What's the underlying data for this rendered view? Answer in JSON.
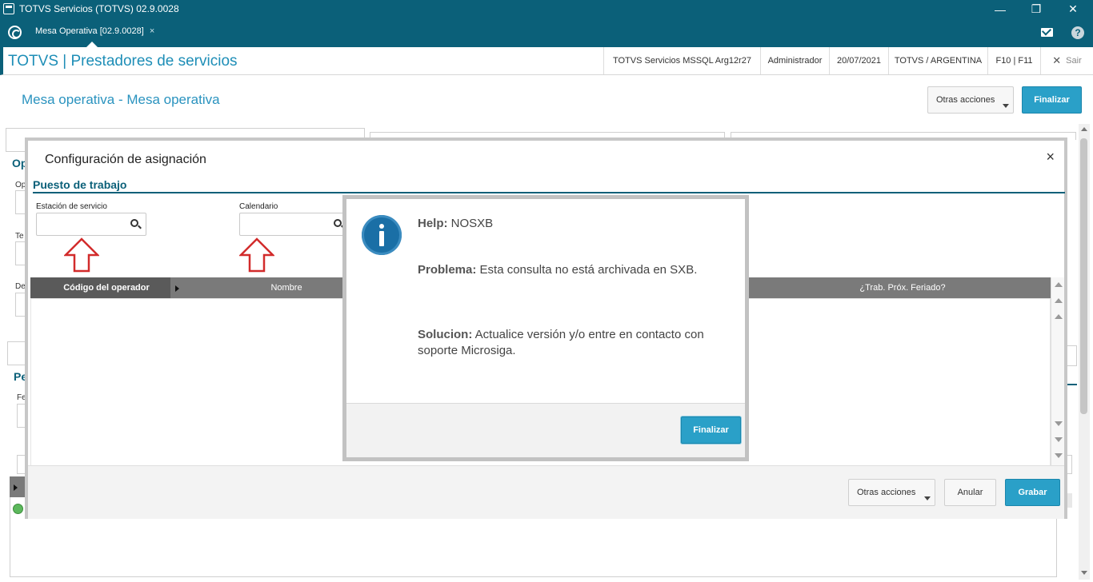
{
  "window": {
    "title": "TOTVS Servicios (TOTVS) 02.9.0028",
    "minimize": "—",
    "restore": "❐",
    "close": "✕"
  },
  "tabs": [
    {
      "label": "Mesa Operativa [02.9.0028]",
      "close": "×"
    }
  ],
  "header": {
    "app_title": "TOTVS | Prestadores de servicios",
    "server": "TOTVS Servicios MSSQL Arg12r27",
    "user": "Administrador",
    "date": "20/07/2021",
    "company": "TOTVS / ARGENTINA",
    "shortcuts": "F10 | F11",
    "exit_label": "Sair"
  },
  "page": {
    "title": "Mesa operativa - Mesa operativa",
    "other_actions": "Otras acciones",
    "finish": "Finalizar"
  },
  "background": {
    "letters": [
      "Op",
      "Op",
      "Te",
      "De",
      "Pe",
      "Fe"
    ]
  },
  "dialog": {
    "title": "Configuración de asignación",
    "close": "×",
    "section": "Puesto de trabajo",
    "fields": {
      "station_label": "Estación de servicio",
      "calendar_label": "Calendario"
    },
    "grid": {
      "columns": [
        "Código del operador",
        "Nombre",
        "¿Trab. Próx. Feriado?"
      ]
    },
    "footer": {
      "other_actions": "Otras acciones",
      "cancel": "Anular",
      "save": "Grabar"
    }
  },
  "help": {
    "help_label": "Help:",
    "help_value": "NOSXB",
    "problem_label": "Problema:",
    "problem_value": "Esta consulta no está archivada en SXB.",
    "solution_label": "Solucion:",
    "solution_value": "Actualice versión y/o entre en contacto con soporte Microsiga.",
    "finish": "Finalizar"
  },
  "colors": {
    "brand_dark": "#0b6079",
    "brand_light": "#2aa0c8",
    "arrow_red": "#d22b2b",
    "info_blue": "#1a6fa6"
  }
}
